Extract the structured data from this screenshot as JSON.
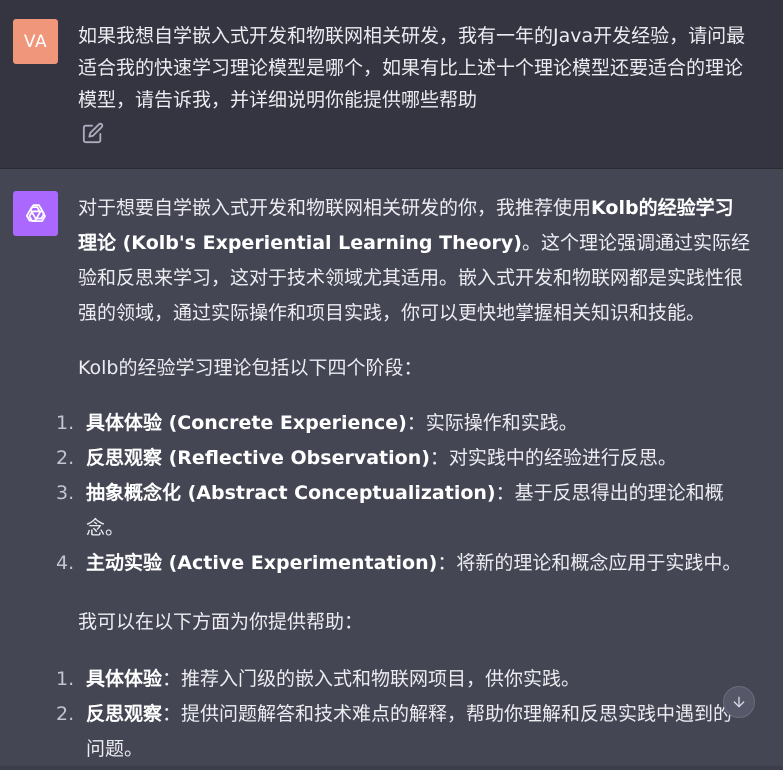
{
  "user": {
    "avatar_text": "VA",
    "message": "如果我想自学嵌入式开发和物联网相关研发，我有一年的Java开发经验，请问最适合我的快速学习理论模型是哪个，如果有比上述十个理论模型还要适合的理论模型，请告诉我，并详细说明你能提供哪些帮助"
  },
  "assistant": {
    "intro_prefix": "对于想要自学嵌入式开发和物联网相关研发的你，我推荐使用",
    "intro_bold": "Kolb的经验学习理论 (Kolb's Experiential Learning Theory)",
    "intro_suffix": "。这个理论强调通过实际经验和反思来学习，这对于技术领域尤其适用。嵌入式开发和物联网都是实践性很强的领域，通过实际操作和项目实践，你可以更快地掌握相关知识和技能。",
    "stages_heading": "Kolb的经验学习理论包括以下四个阶段：",
    "stages": [
      {
        "num": "1.",
        "bold": "具体体验 (Concrete Experience)",
        "text": "：实际操作和实践。"
      },
      {
        "num": "2.",
        "bold": "反思观察 (Reflective Observation)",
        "text": "：对实践中的经验进行反思。"
      },
      {
        "num": "3.",
        "bold": "抽象概念化 (Abstract Conceptualization)",
        "text": "：基于反思得出的理论和概念。"
      },
      {
        "num": "4.",
        "bold": "主动实验 (Active Experimentation)",
        "text": "：将新的理论和概念应用于实践中。"
      }
    ],
    "help_heading": "我可以在以下方面为你提供帮助：",
    "help": [
      {
        "num": "1.",
        "bold": "具体体验",
        "text": "：推荐入门级的嵌入式和物联网项目，供你实践。"
      },
      {
        "num": "2.",
        "bold": "反思观察",
        "text": "：提供问题解答和技术难点的解释，帮助你理解和反思实践中遇到的问题。"
      }
    ]
  },
  "icons": {
    "edit": "edit-icon",
    "bot": "openai-logo-icon",
    "scroll": "arrow-down-icon"
  },
  "colors": {
    "user_bg": "#343541",
    "assistant_bg": "#444654",
    "user_avatar": "#f0977b",
    "bot_avatar": "#ab68ff"
  }
}
